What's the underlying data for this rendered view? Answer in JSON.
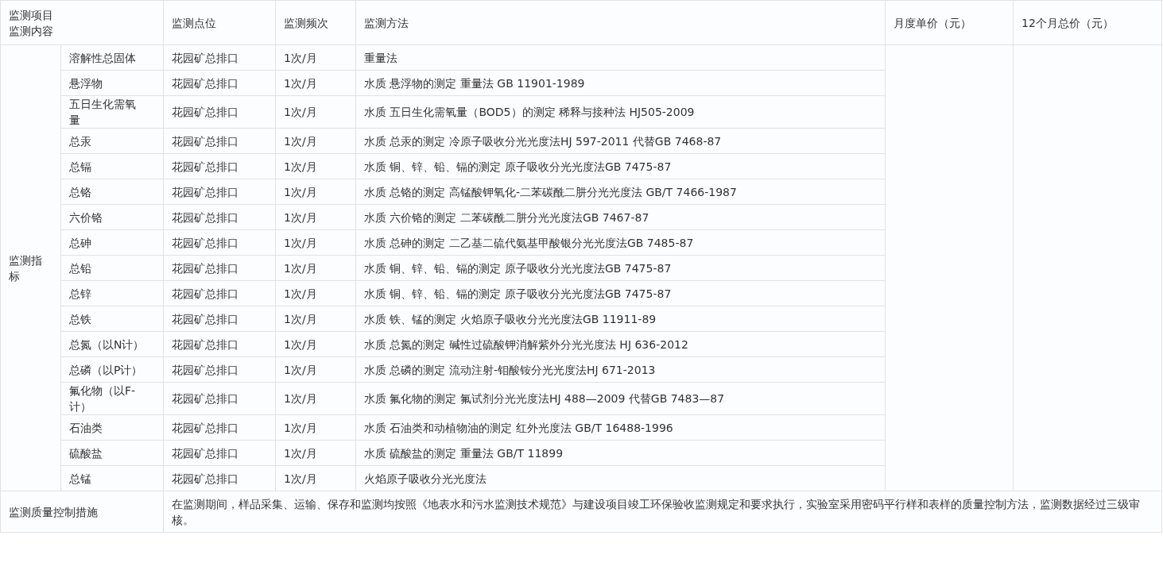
{
  "header": {
    "item_labels": [
      "监测项目",
      "监测内容"
    ],
    "columns": [
      "监测点位",
      "监测频次",
      "监测方法",
      "月度单价（元）",
      "12个月总价（元）"
    ]
  },
  "group_label": "监测指标",
  "rows": [
    {
      "item": "溶解性总固体",
      "point": "花园矿总排口",
      "frequency": "1次/月",
      "method": "重量法"
    },
    {
      "item": "悬浮物",
      "point": "花园矿总排口",
      "frequency": "1次/月",
      "method": "水质 悬浮物的测定 重量法 GB 11901-1989"
    },
    {
      "item": "五日生化需氧量",
      "point": "花园矿总排口",
      "frequency": "1次/月",
      "method": "水质 五日生化需氧量（BOD5）的测定 稀释与接种法 HJ505-2009"
    },
    {
      "item": "总汞",
      "point": "花园矿总排口",
      "frequency": "1次/月",
      "method": "水质 总汞的测定 冷原子吸收分光光度法HJ 597-2011 代替GB 7468-87"
    },
    {
      "item": "总镉",
      "point": "花园矿总排口",
      "frequency": "1次/月",
      "method": "水质 铜、锌、铅、镉的测定 原子吸收分光光度法GB 7475-87"
    },
    {
      "item": "总铬",
      "point": "花园矿总排口",
      "frequency": "1次/月",
      "method": "水质 总铬的测定 高锰酸钾氧化-二苯碳酰二肼分光光度法 GB/T 7466-1987"
    },
    {
      "item": "六价铬",
      "point": "花园矿总排口",
      "frequency": "1次/月",
      "method": "水质 六价铬的测定 二苯碳酰二肼分光光度法GB 7467-87"
    },
    {
      "item": "总砷",
      "point": "花园矿总排口",
      "frequency": "1次/月",
      "method": "水质 总砷的测定 二乙基二硫代氨基甲酸银分光光度法GB 7485-87"
    },
    {
      "item": "总铅",
      "point": "花园矿总排口",
      "frequency": "1次/月",
      "method": "水质 铜、锌、铅、镉的测定 原子吸收分光光度法GB 7475-87"
    },
    {
      "item": "总锌",
      "point": "花园矿总排口",
      "frequency": "1次/月",
      "method": "水质 铜、锌、铅、镉的测定 原子吸收分光光度法GB 7475-87"
    },
    {
      "item": "总铁",
      "point": "花园矿总排口",
      "frequency": "1次/月",
      "method": "水质 铁、锰的测定 火焰原子吸收分光光度法GB 11911-89"
    },
    {
      "item": "总氮（以N计）",
      "point": "花园矿总排口",
      "frequency": "1次/月",
      "method": "水质 总氮的测定 碱性过硫酸钾消解紫外分光光度法 HJ 636-2012"
    },
    {
      "item": "总磷（以P计）",
      "point": "花园矿总排口",
      "frequency": "1次/月",
      "method": "水质 总磷的测定 流动注射-钼酸铵分光光度法HJ 671-2013"
    },
    {
      "item": "氟化物（以F-计）",
      "point": "花园矿总排口",
      "frequency": "1次/月",
      "method": "水质 氟化物的测定 氟试剂分光光度法HJ 488—2009 代替GB 7483—87"
    },
    {
      "item": "石油类",
      "point": "花园矿总排口",
      "frequency": "1次/月",
      "method": "水质 石油类和动植物油的测定 红外光度法 GB/T 16488-1996"
    },
    {
      "item": "硫酸盐",
      "point": "花园矿总排口",
      "frequency": "1次/月",
      "method": "水质 硫酸盐的测定 重量法 GB/T 11899"
    },
    {
      "item": "总锰",
      "point": "花园矿总排口",
      "frequency": "1次/月",
      "method": "火焰原子吸收分光光度法"
    }
  ],
  "quality_control": {
    "label": "监测质量控制措施",
    "text": "在监测期间，样品采集、运输、保存和监测均按照《地表水和污水监测技术规范》与建设项目竣工环保验收监测规定和要求执行，实验室采用密码平行样和表样的质量控制方法，监测数据经过三级审核。"
  }
}
